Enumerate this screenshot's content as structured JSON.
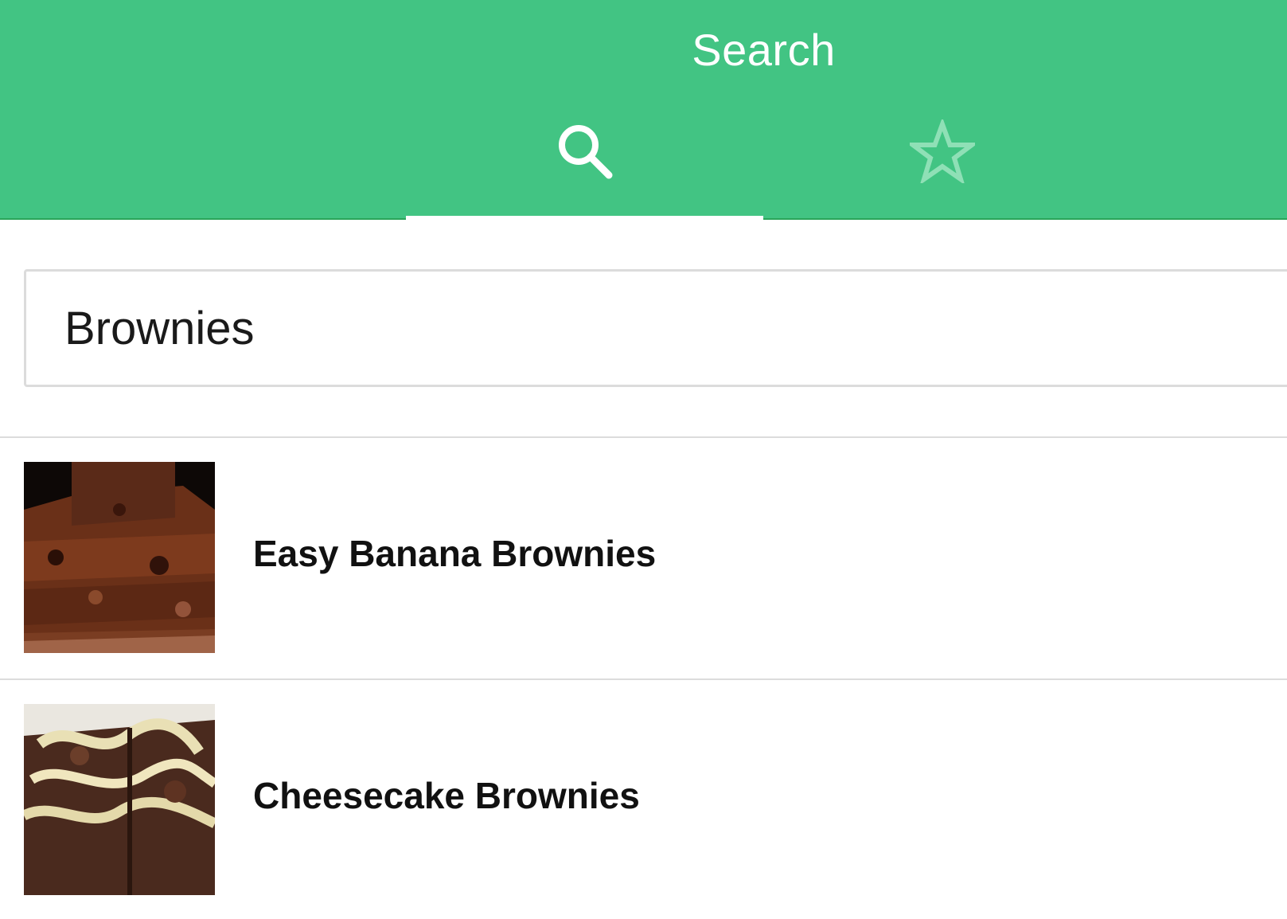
{
  "header": {
    "title": "Search",
    "background": "#42c483",
    "tabs": [
      {
        "icon": "search-icon",
        "selected": true
      },
      {
        "icon": "star-outline-icon",
        "selected": false
      }
    ]
  },
  "search": {
    "value": "Brownies"
  },
  "results": [
    {
      "title": "Easy Banana Brownies",
      "thumbnail": "brownie-photo"
    },
    {
      "title": "Cheesecake Brownies",
      "thumbnail": "cheesecake-brownie-photo"
    }
  ]
}
